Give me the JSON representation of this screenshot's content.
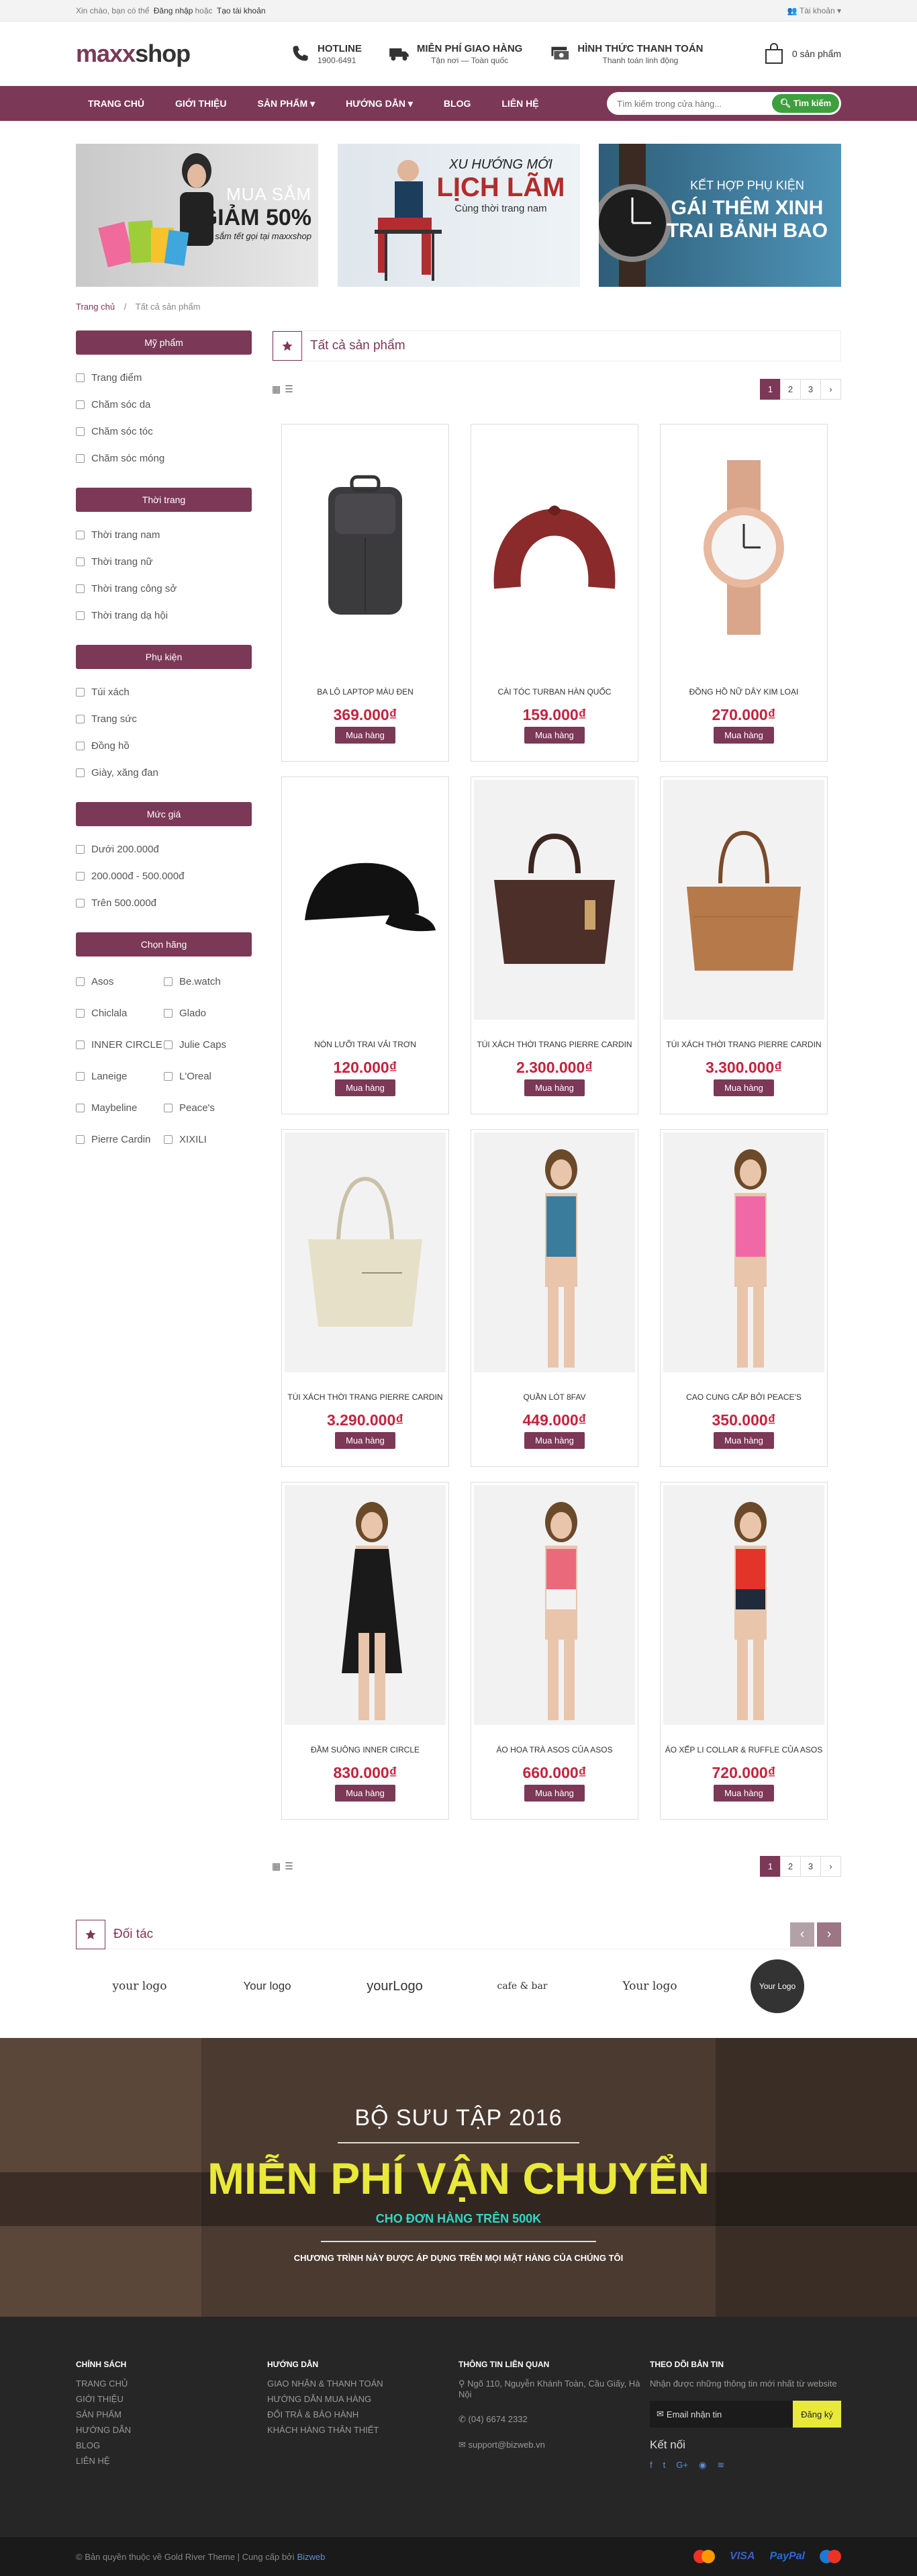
{
  "topbar": {
    "greeting": "Xin chào, bạn có thể",
    "login": "Đăng nhập",
    "or": "hoặc",
    "register": "Tạo tài khoản",
    "account": "Tài khoản"
  },
  "logo": {
    "part1": "maxx",
    "part2": "shop"
  },
  "header": {
    "hotline_title": "HOTLINE",
    "hotline_value": "1900-6491",
    "ship_title": "MIỄN PHÍ GIAO HÀNG",
    "ship_sub": "Tận nơi — Toàn quốc",
    "pay_title": "HÌNH THỨC THANH TOÁN",
    "pay_sub": "Thanh toán linh động",
    "cart": "0 sản phẩm"
  },
  "nav": {
    "items": [
      "TRANG CHỦ",
      "GIỚI THIỆU",
      "SẢN PHẨM",
      "HƯỚNG DẪN",
      "BLOG",
      "LIÊN HỆ"
    ],
    "search_placeholder": "Tìm kiếm trong cửa hàng...",
    "search_button": "Tìm kiếm"
  },
  "banners": {
    "b1_title": "MUA SẮM",
    "b1_sale": "GIẢM 50%",
    "b1_sub": "Mua sắm tết gọi tại maxxshop",
    "b2_top": "XU HƯỚNG MỚI",
    "b2_main": "LỊCH LÃM",
    "b2_sub": "Cùng thời trang nam",
    "b3_top": "KẾT HỢP PHỤ KIỆN",
    "b3_l1": "GÁI THÊM XINH",
    "b3_l2": "TRAI BẢNH BAO"
  },
  "breadcrumb": {
    "home": "Trang chủ",
    "sep": "/",
    "current": "Tất cả sản phẩm"
  },
  "sidebar": {
    "groups": [
      {
        "title": "Mỹ phẩm",
        "items": [
          "Trang điểm",
          "Chăm sóc da",
          "Chăm sóc tóc",
          "Chăm sóc móng"
        ]
      },
      {
        "title": "Thời trang",
        "items": [
          "Thời trang nam",
          "Thời trang nữ",
          "Thời trang công sở",
          "Thời trang dạ hội"
        ]
      },
      {
        "title": "Phụ kiện",
        "items": [
          "Túi xách",
          "Trang sức",
          "Đồng hồ",
          "Giày, xăng đan"
        ]
      },
      {
        "title": "Mức giá",
        "items": [
          "Dưới 200.000đ",
          "200.000đ - 500.000đ",
          "Trên 500.000đ"
        ]
      }
    ],
    "brand_title": "Chọn hãng",
    "brands": [
      "Asos",
      "Be.watch",
      "Chiclala",
      "Glado",
      "INNER CIRCLE",
      "Julie Caps",
      "Laneige",
      "L'Oreal",
      "Maybeline",
      "Peace's",
      "Pierre Cardin",
      "XIXILI"
    ]
  },
  "content": {
    "title": "Tất cả sản phẩm",
    "pages": [
      "1",
      "2",
      "3",
      "›"
    ],
    "buy_label": "Mua hàng",
    "products": [
      {
        "name": "BA LÔ LAPTOP MÀU ĐEN",
        "price": "369.000₫",
        "kind": "backpack"
      },
      {
        "name": "CÀI TÓC TURBAN HÀN QUỐC",
        "price": "159.000₫",
        "kind": "headband"
      },
      {
        "name": "ĐỒNG HỒ NỮ DÂY KIM LOẠI",
        "price": "270.000₫",
        "kind": "watch"
      },
      {
        "name": "NÓN LƯỠI TRAI VẢI TRƠN",
        "price": "120.000₫",
        "kind": "cap"
      },
      {
        "name": "TÚI XÁCH THỜI TRANG PIERRE CARDIN",
        "price": "2.300.000₫",
        "kind": "bag-dark"
      },
      {
        "name": "TÚI XÁCH THỜI TRANG PIERRE CARDIN",
        "price": "3.300.000₫",
        "kind": "bag-tan"
      },
      {
        "name": "TÚI XÁCH THỜI TRANG PIERRE CARDIN",
        "price": "3.290.000₫",
        "kind": "bag-cream"
      },
      {
        "name": "QUẦN LÓT 8FAV",
        "price": "449.000₫",
        "kind": "model-blue"
      },
      {
        "name": "CAO CUNG CẤP BỞI PEACE'S",
        "price": "350.000₫",
        "kind": "model-pink"
      },
      {
        "name": "ĐẦM SUÔNG INNER CIRCLE",
        "price": "830.000₫",
        "kind": "model-black"
      },
      {
        "name": "ÁO HOA TRÀ ASOS CỦA ASOS",
        "price": "660.000₫",
        "kind": "model-rose"
      },
      {
        "name": "ÁO XẾP LI COLLAR & RUFFLE CỦA ASOS",
        "price": "720.000₫",
        "kind": "model-red"
      }
    ]
  },
  "partners": {
    "title": "Đối tác",
    "logos": [
      "your logo",
      "Your logo",
      "yourLogo",
      "cafe & bar",
      "Your logo",
      "Your Logo"
    ]
  },
  "promo": {
    "line1": "BỘ SƯU TẬP 2016",
    "line2": "MIỄN PHÍ VẬN CHUYỂN",
    "line3": "CHO ĐƠN HÀNG TRÊN 500K",
    "line4": "CHƯƠNG TRÌNH NÀY ĐƯỢC ÁP DỤNG TRÊN MỌI MẶT HÀNG CỦA CHÚNG TÔI"
  },
  "footer": {
    "col1_title": "CHÍNH SÁCH",
    "col1_items": [
      "TRANG CHỦ",
      "GIỚI THIỆU",
      "SẢN PHẨM",
      "HƯỚNG DẪN",
      "BLOG",
      "LIÊN HỆ"
    ],
    "col2_title": "Hướng dẫn",
    "col2_items": [
      "GIAO NHẬN & THANH TOÁN",
      "HƯỚNG DẪN MUA HÀNG",
      "ĐỔI TRẢ & BẢO HÀNH",
      "KHÁCH HÀNG THÂN THIẾT"
    ],
    "col3_title": "THÔNG TIN LIÊN QUAN",
    "address": "Ngõ 110, Nguyễn Khánh Toàn, Cầu Giấy, Hà Nội",
    "phone": "(04) 6674 2332",
    "email": "support@bizweb.vn",
    "col4_title": "THEO DÕI BẢN TIN",
    "col4_desc": "Nhận được những thông tin mới nhất từ website",
    "email_placeholder": "Email nhận tin",
    "subscribe": "Đăng ký",
    "connect": "Kết nối"
  },
  "copyright": {
    "text": "© Bản quyền thuộc về Gold River Theme | Cung cấp bởi",
    "brand": "Bizweb",
    "payments": [
      "mastercard",
      "VISA",
      "PayPal",
      "maestro"
    ]
  },
  "colors": {
    "brand": "#7c3857",
    "price": "#c4233e",
    "search_btn": "#3e9f3e",
    "promo_yellow": "#e9e93a",
    "promo_cyan": "#35d6c6"
  }
}
